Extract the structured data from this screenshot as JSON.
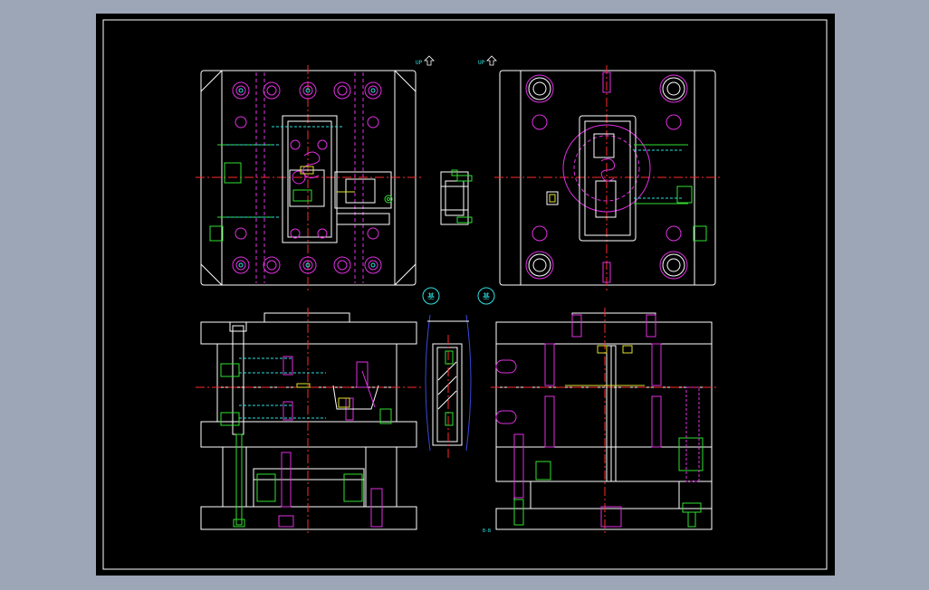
{
  "drawing": {
    "labels": {
      "up_left": "UP",
      "up_right": "UP",
      "datum_left": "基",
      "datum_right": "基",
      "section_tag": "B-B"
    }
  },
  "icons": [
    "up-arrow-icon",
    "datum-symbol-icon"
  ],
  "colors": {
    "background": "#000000",
    "frame": "#ffffff",
    "outline": "#ffffff",
    "centerline": "#ff2a2a",
    "magenta": "#e030e0",
    "green": "#30e030",
    "cyan": "#30e0e0",
    "blue": "#3a4ad8",
    "yellow": "#e0e030",
    "window_border": "#9da6b7"
  }
}
